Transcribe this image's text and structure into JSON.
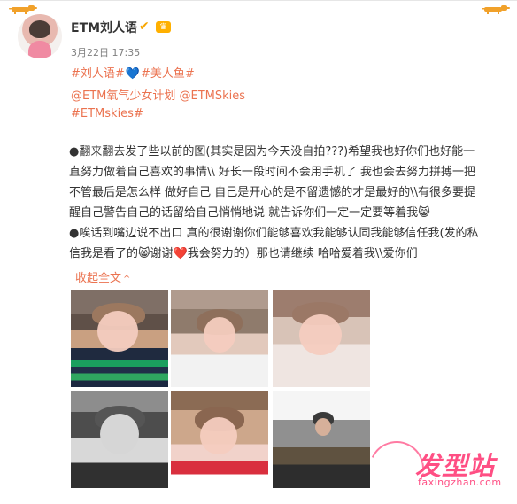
{
  "post": {
    "user_name": "ETM刘人语",
    "verified_icon": "verified-badge-icon",
    "member_icon": "vip-member-icon",
    "time": "3月22日 17:35",
    "tags": {
      "line1_part1": "#刘人语#",
      "line1_part2": "#美人鱼#",
      "line2": "@ETM氧气少女计划 @ETMSkies",
      "line3": "#ETMskies#"
    },
    "body_lines": [
      "●翻来翻去发了些以前的图(其实是因为今天没自拍???)希望我也好你们也好能一",
      "直努力做着自己喜欢的事情\\\\ 好长一段时间不会用手机了 我也会去努力拼搏一把",
      "不管最后是怎么样 做好自己 自己是开心的是不留遗憾的才是最好的\\\\有很多要提",
      "醒自己警告自己的话留给自己悄悄地说 就告诉你们一定一定要等着我😸",
      "●唉话到嘴边说不出口 真的很谢谢你们能够喜欢我能够认同我能够信任我(发的私",
      "信我是看了的😸谢谢❤️我会努力的）那也请继续 哈哈爱着我\\\\爱你们"
    ],
    "collapse_label": "收起全文",
    "collapse_caret": "^"
  },
  "images": [
    {
      "name": "photo-green-striped-sweater"
    },
    {
      "name": "photo-white-shirt"
    },
    {
      "name": "photo-closeup-striped-turtleneck"
    },
    {
      "name": "photo-monochrome-portrait"
    },
    {
      "name": "photo-red-top-portrait"
    },
    {
      "name": "photo-full-length-mirror"
    }
  ],
  "watermark": {
    "logo_text": "发型站",
    "site_text": "faxingzhan.com"
  },
  "colors": {
    "accent": "#eb7350",
    "blue_heart": "#1d86ff",
    "verified": "#f7a600",
    "watermark": "#ff4f84"
  }
}
